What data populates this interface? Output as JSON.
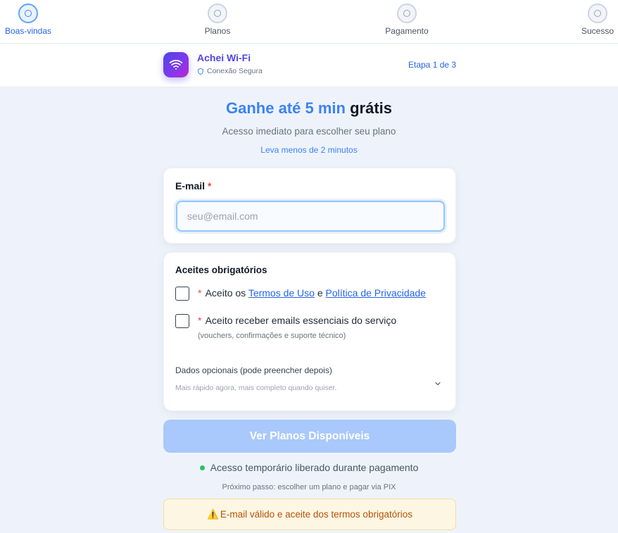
{
  "stepper": {
    "steps": [
      {
        "label": "Boas-vindas",
        "active": true
      },
      {
        "label": "Planos",
        "active": false
      },
      {
        "label": "Pagamento",
        "active": false
      },
      {
        "label": "Sucesso",
        "active": false
      }
    ]
  },
  "header": {
    "app_name": "Achei Wi-Fi",
    "secure_label": "Conexão Segura",
    "step_indicator": "Etapa 1 de 3",
    "logo_icon": "wifi-icon"
  },
  "hero": {
    "title_accent": "Ganhe até 5 min",
    "title_rest": "grátis",
    "subtitle": "Acesso imediato para escolher seu plano",
    "note": "Leva menos de 2 minutos"
  },
  "email_card": {
    "label": "E-mail",
    "required_mark": "*",
    "placeholder": "seu@email.com",
    "value": ""
  },
  "terms_card": {
    "title": "Aceites obrigatórios",
    "terms": {
      "required_mark": "*",
      "prefix": "Aceito os",
      "terms_link": "Termos de Uso",
      "conjunction": "e",
      "privacy_link": "Política de Privacidade",
      "checked": false
    },
    "emails": {
      "required_mark": "*",
      "label": "Aceito receber emails essenciais do serviço",
      "hint": "(vouchers, confirmações e suporte técnico)",
      "checked": false
    },
    "optional": {
      "title": "Dados opcionais (pode preencher depois)",
      "subtitle": "Mais rápido agora, mais completo quando quiser.",
      "expanded": false
    }
  },
  "cta": {
    "label": "Ver Planos Disponíveis",
    "enabled": false
  },
  "footer": {
    "access_text": "Acesso temporário liberado durante pagamento",
    "next_step": "Próximo passo: escolher um plano e pagar via PIX",
    "warning_icon": "⚠️",
    "warning_text": "E-mail válido e aceite dos termos obrigatórios"
  },
  "colors": {
    "accent": "#3b82f6",
    "brand_gradient_start": "#4f46e5",
    "brand_gradient_end": "#c026d3",
    "cta_disabled": "#a9c8fb",
    "warning_bg": "#fdf6e3",
    "warning_text": "#b45309",
    "status_green": "#22c55e"
  }
}
